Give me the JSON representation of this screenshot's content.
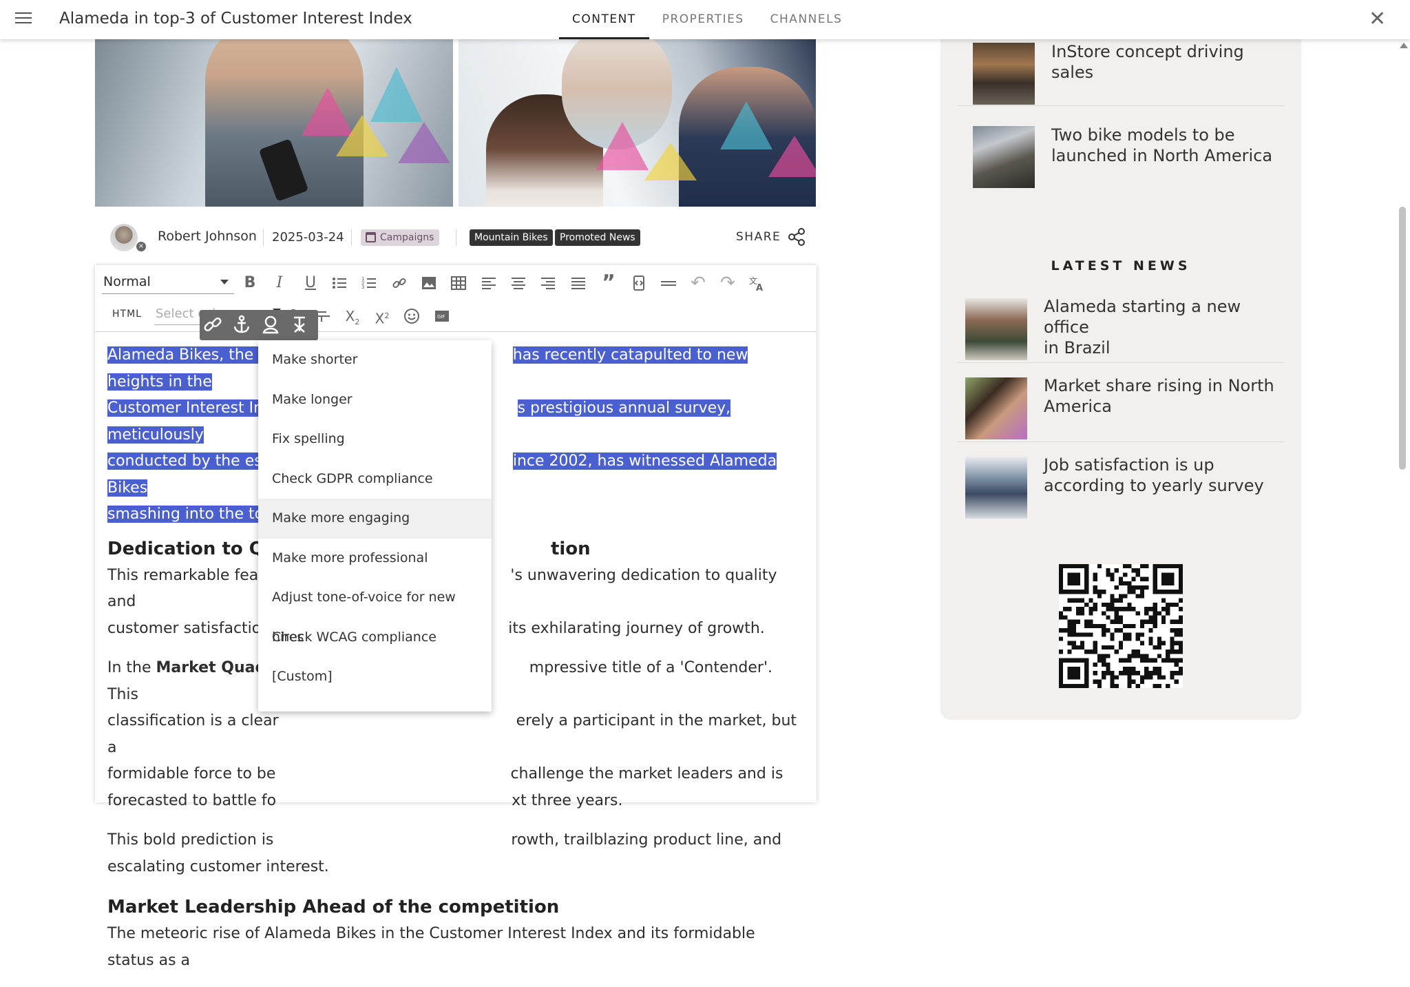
{
  "header": {
    "title": "Alameda in top-3 of Customer Interest Index",
    "tabs": [
      {
        "label": "CONTENT",
        "active": true
      },
      {
        "label": "PROPERTIES",
        "active": false
      },
      {
        "label": "CHANNELS",
        "active": false
      }
    ]
  },
  "article": {
    "author": "Robert Johnson",
    "date": "2025-03-24",
    "category_tag": "Campaigns",
    "tags": [
      "Mountain Bikes",
      "Promoted News"
    ],
    "share_label": "SHARE"
  },
  "editor": {
    "format_select": "Normal",
    "html_label": "HTML",
    "color_placeholder": "Select color",
    "content": {
      "p1_lines": [
        "Alameda Bikes, the ne",
        "has recently catapulted to new heights in the",
        "Customer Interest Inde",
        "s prestigious annual survey, meticulously",
        "conducted by the este",
        "ince 2002, has witnessed Alameda Bikes",
        "smashing into the top"
      ],
      "h1_left": "Dedication to Qua",
      "h1_right": "tion",
      "p2_l1a": "This remarkable feat is",
      "p2_l1b": "'s unwavering dedication to quality and",
      "p2_l2a": "customer satisfaction,",
      "p2_l2b": "its exhilarating journey of growth.",
      "p3_l1a": "In the ",
      "p3_l1bold": "Market Quadrar",
      "p3_l1b": "mpressive title of a 'Contender'. This",
      "p3_l2a": "classification is a clear",
      "p3_l2b": "erely a participant in the market, but a",
      "p3_l3a": "formidable force to be",
      "p3_l3b": "challenge the market leaders and is",
      "p3_l4a": "forecasted to battle fo",
      "p3_l4b": "xt three years.",
      "p4_l1a": "This bold prediction is",
      "p4_l1b": "rowth, trailblazing product line, and",
      "p4_l2a": "escalating customer interest.",
      "h2": "Market Leadership Ahead of the competition",
      "p5": "The meteoric rise of Alameda Bikes in the Customer Interest Index and its formidable status as a"
    }
  },
  "ai_menu": {
    "items": [
      "Make shorter",
      "Make longer",
      "Fix spelling",
      "Check GDPR compliance",
      "Make more engaging",
      "Make more professional",
      "Adjust tone-of-voice for new hires",
      "Check WCAG compliance",
      "[Custom]"
    ],
    "highlighted": "Make more engaging"
  },
  "sidebar": {
    "related": [
      {
        "title_l1": "InStore concept driving",
        "title_l2": "sales"
      },
      {
        "title_l1": "Two bike models to be",
        "title_l2": "launched in North America"
      }
    ],
    "latest_title": "LATEST NEWS",
    "latest": [
      {
        "title_l1": "Alameda starting a new office",
        "title_l2": "in Brazil"
      },
      {
        "title_l1": "Market share rising in North",
        "title_l2": "America"
      },
      {
        "title_l1": "Job satisfaction is up",
        "title_l2": "according to yearly survey"
      }
    ]
  },
  "colors": {
    "selection": "#4a5fd0",
    "panel_bg": "#f2f0ee",
    "tag_dark": "#333333",
    "tag_campaign": "#ddd4dc"
  }
}
